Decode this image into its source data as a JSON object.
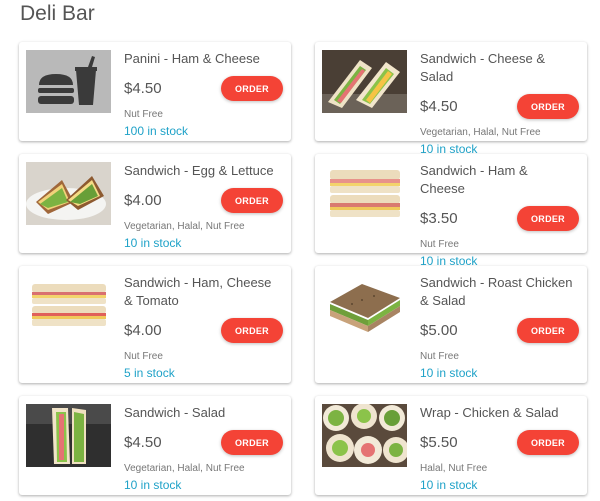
{
  "page": {
    "title": "Deli Bar"
  },
  "theme": {
    "accent": "#f44336",
    "stock_color": "#1fa2c8"
  },
  "products": [
    {
      "name": "Panini - Ham & Cheese",
      "price": "$4.50",
      "button": "ORDER",
      "tags": "Nut Free",
      "stock": "100 in stock",
      "image": "burger-drink-placeholder-icon"
    },
    {
      "name": "Sandwich - Cheese & Salad",
      "price": "$4.50",
      "button": "ORDER",
      "tags": "Vegetarian, Halal, Nut Free",
      "stock": "10 in stock",
      "image": "cheese-salad-sandwich-photo"
    },
    {
      "name": "Sandwich - Egg & Lettuce",
      "price": "$4.00",
      "button": "ORDER",
      "tags": "Vegetarian, Halal, Nut Free",
      "stock": "10 in stock",
      "image": "egg-lettuce-sandwich-photo"
    },
    {
      "name": "Sandwich - Ham & Cheese",
      "price": "$3.50",
      "button": "ORDER",
      "tags": "Nut Free",
      "stock": "10 in stock",
      "image": "ham-cheese-sandwich-photo"
    },
    {
      "name": "Sandwich - Ham, Cheese & Tomato",
      "price": "$4.00",
      "button": "ORDER",
      "tags": "Nut Free",
      "stock": "5 in stock",
      "image": "ham-cheese-tomato-sandwich-photo"
    },
    {
      "name": "Sandwich - Roast Chicken & Salad",
      "price": "$5.00",
      "button": "ORDER",
      "tags": "Nut Free",
      "stock": "10 in stock",
      "image": "roast-chicken-sandwich-photo"
    },
    {
      "name": "Sandwich - Salad",
      "price": "$4.50",
      "button": "ORDER",
      "tags": "Vegetarian, Halal, Nut Free",
      "stock": "10 in stock",
      "image": "salad-sandwich-photo"
    },
    {
      "name": "Wrap - Chicken & Salad",
      "price": "$5.50",
      "button": "ORDER",
      "tags": "Halal, Nut Free",
      "stock": "10 in stock",
      "image": "chicken-wrap-photo"
    }
  ]
}
